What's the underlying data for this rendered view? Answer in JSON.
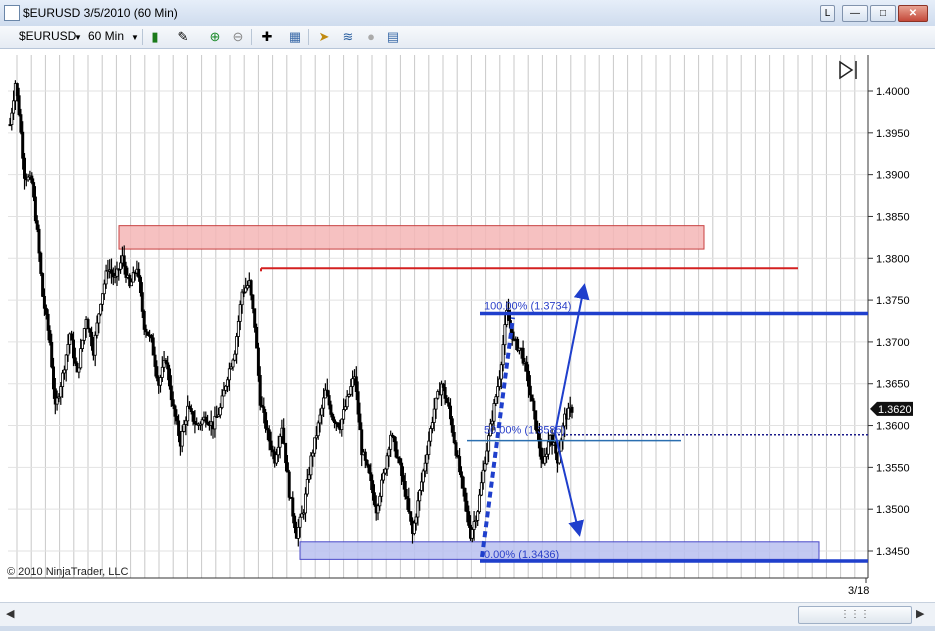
{
  "window": {
    "title": "$EURUSD  3/5/2010 (60 Min)",
    "button_l": "L"
  },
  "toolbar": {
    "instrument": "$EURUSD",
    "interval": "60 Min"
  },
  "chart_data": {
    "type": "candlestick",
    "instrument": "$EURUSD",
    "interval": "60 Min",
    "ylim": [
      1.3424,
      1.4063
    ],
    "y_ticks": [
      "1.4000",
      "1.3950",
      "1.3900",
      "1.3850",
      "1.3800",
      "1.3750",
      "1.3700",
      "1.3650",
      "1.3600",
      "1.3550",
      "1.3500",
      "1.3450"
    ],
    "x_tick_label": "3/18",
    "last_price": "1.3620",
    "copyright": "© 2010 NinjaTrader, LLC",
    "price_path": [
      [
        0,
        1.396
      ],
      [
        3,
        1.401
      ],
      [
        5,
        1.3975
      ],
      [
        8,
        1.39
      ],
      [
        12,
        1.389
      ],
      [
        15,
        1.383
      ],
      [
        18,
        1.3755
      ],
      [
        22,
        1.37
      ],
      [
        25,
        1.362
      ],
      [
        29,
        1.366
      ],
      [
        33,
        1.371
      ],
      [
        37,
        1.366
      ],
      [
        42,
        1.373
      ],
      [
        46,
        1.369
      ],
      [
        50,
        1.375
      ],
      [
        54,
        1.379
      ],
      [
        58,
        1.3775
      ],
      [
        62,
        1.38
      ],
      [
        66,
        1.3765
      ],
      [
        70,
        1.379
      ],
      [
        74,
        1.372
      ],
      [
        78,
        1.37
      ],
      [
        82,
        1.365
      ],
      [
        86,
        1.368
      ],
      [
        90,
        1.362
      ],
      [
        94,
        1.358
      ],
      [
        98,
        1.362
      ],
      [
        103,
        1.36
      ],
      [
        108,
        1.361
      ],
      [
        112,
        1.36
      ],
      [
        116,
        1.362
      ],
      [
        120,
        1.366
      ],
      [
        124,
        1.369
      ],
      [
        128,
        1.376
      ],
      [
        132,
        1.377
      ],
      [
        135,
        1.372
      ],
      [
        138,
        1.363
      ],
      [
        142,
        1.359
      ],
      [
        146,
        1.356
      ],
      [
        150,
        1.36
      ],
      [
        154,
        1.352
      ],
      [
        158,
        1.347
      ],
      [
        162,
        1.35
      ],
      [
        166,
        1.356
      ],
      [
        170,
        1.36
      ],
      [
        174,
        1.364
      ],
      [
        178,
        1.361
      ],
      [
        182,
        1.36
      ],
      [
        186,
        1.363
      ],
      [
        190,
        1.366
      ],
      [
        194,
        1.357
      ],
      [
        198,
        1.354
      ],
      [
        202,
        1.35
      ],
      [
        206,
        1.354
      ],
      [
        210,
        1.359
      ],
      [
        214,
        1.356
      ],
      [
        218,
        1.352
      ],
      [
        222,
        1.347
      ],
      [
        226,
        1.352
      ],
      [
        230,
        1.357
      ],
      [
        234,
        1.362
      ],
      [
        238,
        1.365
      ],
      [
        242,
        1.362
      ],
      [
        246,
        1.357
      ],
      [
        250,
        1.352
      ],
      [
        254,
        1.347
      ],
      [
        258,
        1.35
      ],
      [
        262,
        1.356
      ],
      [
        266,
        1.361
      ],
      [
        270,
        1.366
      ],
      [
        274,
        1.3734
      ],
      [
        278,
        1.37
      ],
      [
        282,
        1.369
      ],
      [
        286,
        1.365
      ],
      [
        290,
        1.36
      ],
      [
        294,
        1.355
      ],
      [
        298,
        1.359
      ],
      [
        302,
        1.356
      ],
      [
        306,
        1.361
      ],
      [
        310,
        1.362
      ]
    ],
    "annotations": [
      {
        "type": "zone",
        "label": "",
        "price_top": 1.3839,
        "price_bottom": 1.3811,
        "color": "#f4b6b6"
      },
      {
        "type": "level",
        "label": "",
        "price": 1.3788,
        "color": "#d42020"
      },
      {
        "type": "level",
        "label": "100.00% (1.3734)",
        "price": 1.3734,
        "color": "#1f3fcc"
      },
      {
        "type": "level",
        "label": "50.00% (1.3585)",
        "price": 1.3582,
        "color": "#2b6fb0"
      },
      {
        "type": "zone",
        "label": "",
        "price_top": 1.3461,
        "price_bottom": 1.344,
        "color": "#b8bff0"
      },
      {
        "type": "level",
        "label": "0.00% (1.3436)",
        "price": 1.3438,
        "color": "#1f3fcc"
      }
    ],
    "fib_labels": {
      "top": "100.00% (1.3734)",
      "mid": "50.00% (1.3585)",
      "bottom": "0.00% (1.3436)"
    }
  }
}
